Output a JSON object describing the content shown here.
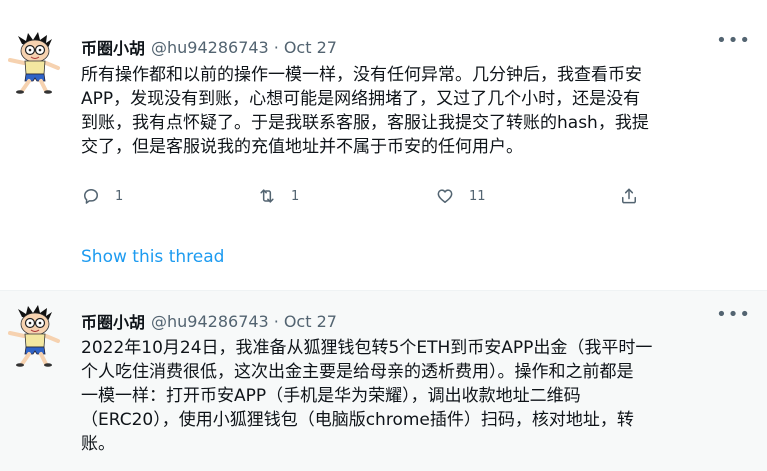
{
  "tweets": [
    {
      "author_name": "币圈小胡",
      "handle": "@hu94286743",
      "separator": "·",
      "date": "Oct 27",
      "more": "•••",
      "lines": [
        "所有操作都和以前的操作一模一样，没有任何异常。几分钟后，我查看币安",
        "APP，发现没有到账，心想可能是网络拥堵了，又过了几个小时，还是没有",
        "到账，我有点怀疑了。于是我联系客服，客服让我提交了转账的hash，我提",
        "交了，但是客服说我的充值地址并不属于币安的任何用户。"
      ],
      "replies": "1",
      "retweets": "1",
      "likes": "11",
      "show_thread": "Show this thread"
    },
    {
      "author_name": "币圈小胡",
      "handle": "@hu94286743",
      "separator": "·",
      "date": "Oct 27",
      "more": "•••",
      "lines": [
        "2022年10月24日，我准备从狐狸钱包转5个ETH到币安APP出金（我平时一",
        "个人吃住消费很低，这次出金主要是给母亲的透析费用）。操作和之前都是",
        "一模一样：打开币安APP（手机是华为荣耀），调出收款地址二维码",
        "（ERC20），使用小狐狸钱包（电脑版chrome插件）扫码，核对地址，转",
        "账。"
      ]
    }
  ],
  "icons": {
    "reply": "speech-bubble-icon",
    "retweet": "retweet-arrows-icon",
    "like": "heart-icon",
    "share": "share-upload-icon"
  },
  "colors": {
    "link": "#1d9bf0",
    "secondary_text": "#536471",
    "primary_text": "#0f1419"
  }
}
